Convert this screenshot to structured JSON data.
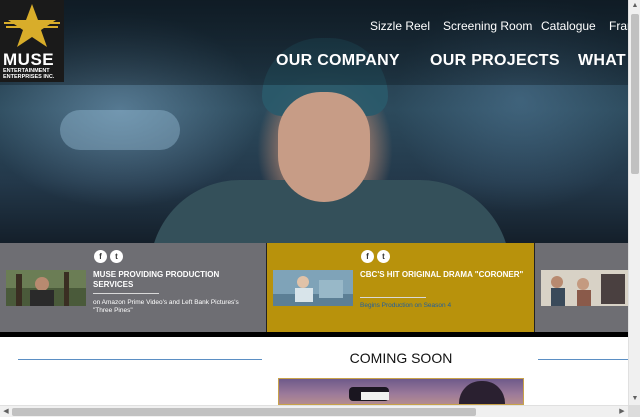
{
  "logo": {
    "brand": "MUSE",
    "subtitle": "ENTERTAINMENT ENTERPRISES INC.",
    "star_color": "#d8ad2a"
  },
  "top_nav": [
    "Sizzle Reel",
    "Screening Room",
    "Catalogue",
    "Fran"
  ],
  "main_nav": [
    "OUR COMPANY",
    "OUR PROJECTS",
    "WHAT W"
  ],
  "news": [
    {
      "title": "MUSE PROVIDING PRODUCTION SERVICES",
      "desc": "on Amazon Prime Video's and Left Bank Pictures's \"Three Pines\"",
      "color": "#6e6e73"
    },
    {
      "title": "CBC'S HIT ORIGINAL DRAMA \"CORONER\"",
      "desc": "Begins Production on Season 4",
      "color": "#b8920c"
    }
  ],
  "social": {
    "facebook": "f",
    "twitter": "t"
  },
  "coming_soon": {
    "heading": "COMING SOON"
  },
  "scroll": {
    "up": "▲",
    "down": "▼",
    "left": "◀",
    "right": "▶"
  }
}
